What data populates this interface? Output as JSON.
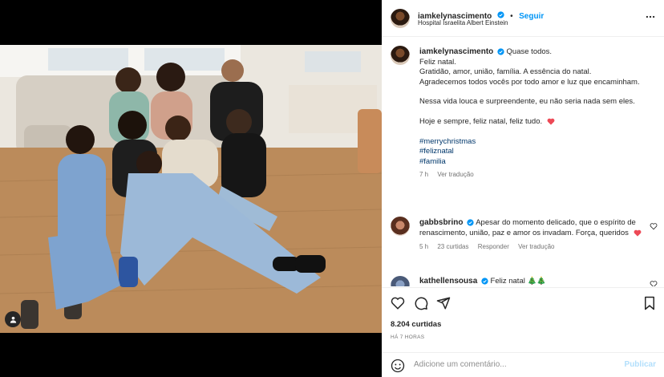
{
  "post": {
    "username": "iamkelynascimento",
    "follow_label": "Seguir",
    "dot": "•",
    "location": "Hospital Israelita Albert Einstein"
  },
  "caption": {
    "username": "iamkelynascimento",
    "line1": "Quase todos.",
    "line2": "Feliz natal.",
    "line3": "Gratidão, amor, união, família. A essência do natal.",
    "line4": "Agradecemos todos vocês por todo amor e luz que encaminham.",
    "line5": "Nessa vida louca e surpreendente, eu não seria nada sem eles.",
    "line6": "Hoje e sempre, feliz natal, feliz tudo.",
    "tags": [
      "#merrychristmas",
      "#feliznatal",
      "#familia"
    ],
    "time": "7 h",
    "translate": "Ver tradução"
  },
  "comments": [
    {
      "username": "gabbsbrino",
      "text": "Apesar do momento delicado, que o espírito de renascimento, união, paz e amor os invadam. Força, queridos",
      "time": "5 h",
      "likes": "23 curtidas",
      "reply": "Responder",
      "translate": "Ver tradução"
    },
    {
      "username": "kathellensousa",
      "text": "Feliz natal 🎄🎄"
    }
  ],
  "stats": {
    "likes": "8.204 curtidas",
    "time": "HÁ 7 HORAS"
  },
  "add_comment": {
    "placeholder": "Adicione um comentário...",
    "publish": "Publicar"
  },
  "colors": {
    "verified": "#0095f6",
    "heart": "#ed4956",
    "link": "#00376b",
    "follow": "#0095f6"
  },
  "icons": [
    "heart-icon",
    "comment-icon",
    "share-icon",
    "save-icon",
    "more-icon",
    "emoji-icon",
    "user-tag-icon"
  ]
}
